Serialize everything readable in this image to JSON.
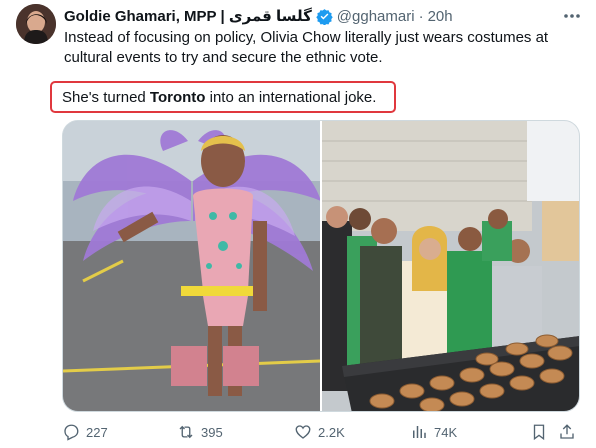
{
  "author": {
    "name": "Goldie Ghamari, MPP",
    "name_script": "| گلسا قمری",
    "handle": "@gghamari",
    "separator": "·",
    "time": "20h"
  },
  "tweet": {
    "text": "Instead of focusing on policy, Olivia Chow literally just wears costumes at cultural events  to try and secure the ethnic vote."
  },
  "quote": {
    "before": "She's turned ",
    "bold": "Toronto",
    "after": " into an international joke."
  },
  "stats": {
    "replies": "227",
    "reposts": "395",
    "likes": "2.2K",
    "views": "74K"
  },
  "colors": {
    "verified": "#1d9bf0",
    "highlight_border": "#e0383e",
    "muted": "#536471"
  },
  "icons": [
    "more-icon",
    "verified-badge-icon",
    "reply-icon",
    "repost-icon",
    "like-icon",
    "views-icon",
    "bookmark-icon",
    "share-icon"
  ]
}
